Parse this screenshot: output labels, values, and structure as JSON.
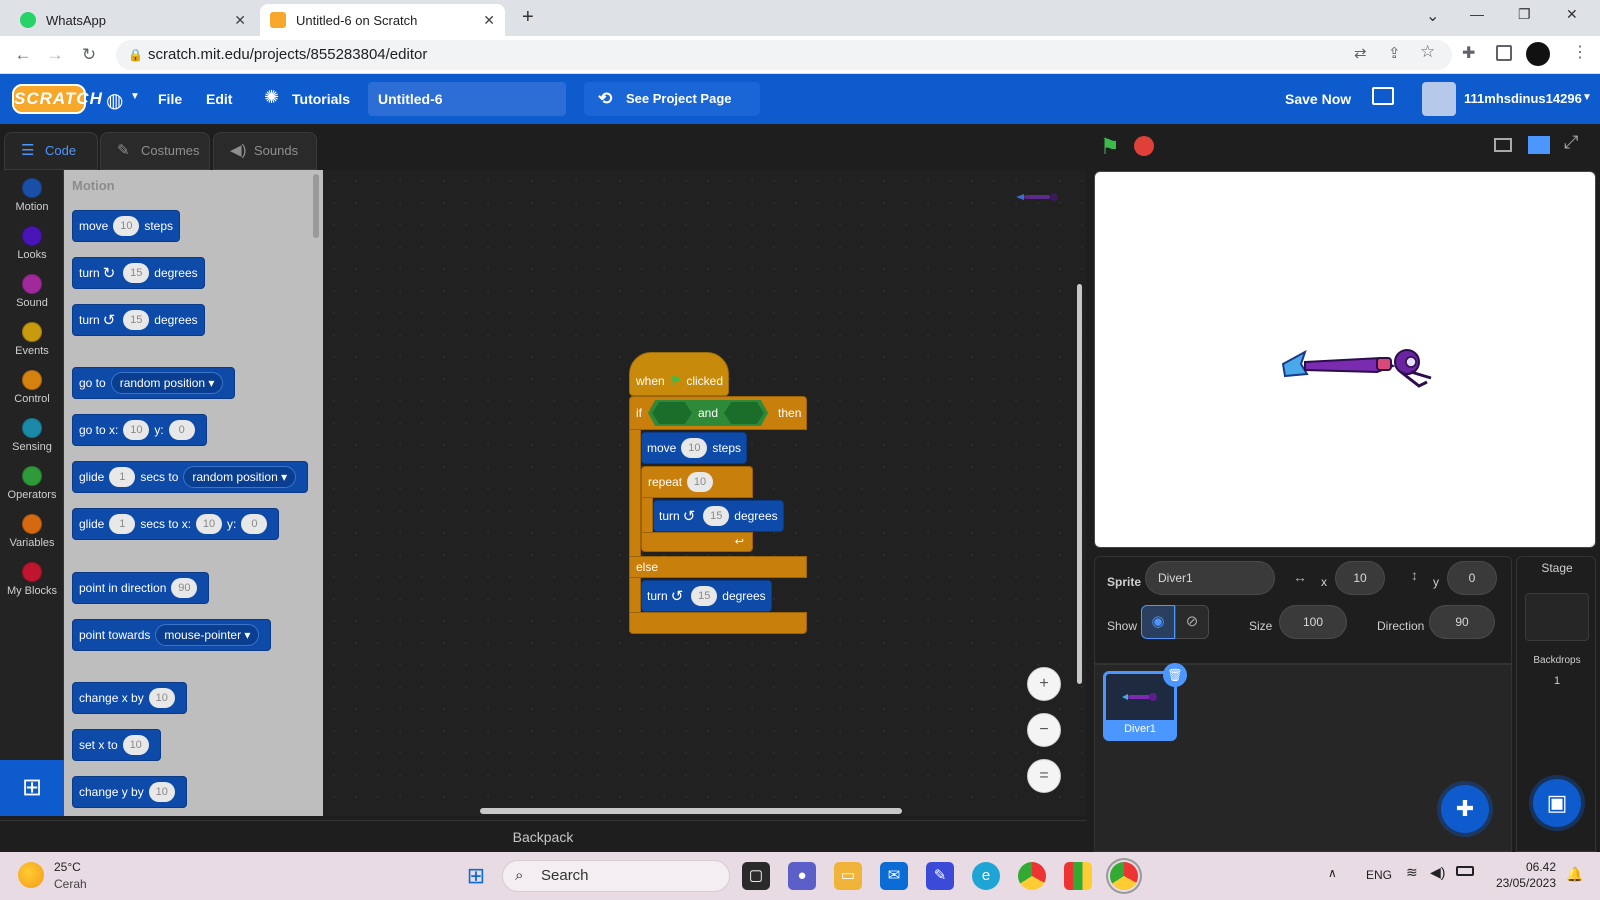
{
  "browser": {
    "tabs": [
      {
        "title": "WhatsApp",
        "active": false,
        "favicon": "whatsapp-icon",
        "color": "#25d366"
      },
      {
        "title": "Untitled-6 on Scratch",
        "active": true,
        "favicon": "scratch-icon",
        "color": "#f7a72a"
      }
    ],
    "new_tab": "+",
    "url": "scratch.mit.edu/projects/855283804/editor",
    "window_controls": {
      "dropdown": "⌄",
      "minimize": "—",
      "restore": "❐",
      "close": "✕"
    }
  },
  "menubar": {
    "logo": "SCRATCH",
    "language_icon": "globe-icon",
    "file": "File",
    "edit": "Edit",
    "tutorials": "Tutorials",
    "project_title": "Untitled-6",
    "see_project_page": "See Project Page",
    "save_now": "Save Now",
    "username": "111mhsdinus14296",
    "accent": "#0e5bce"
  },
  "editor_tabs": [
    {
      "label": "Code",
      "icon": "code-icon",
      "active": true
    },
    {
      "label": "Costumes",
      "icon": "brush-icon",
      "active": false
    },
    {
      "label": "Sounds",
      "icon": "speaker-icon",
      "active": false
    }
  ],
  "categories": [
    {
      "label": "Motion",
      "color": "#1a4fa8"
    },
    {
      "label": "Looks",
      "color": "#4a15b8"
    },
    {
      "label": "Sound",
      "color": "#a02a9c"
    },
    {
      "label": "Events",
      "color": "#c89a0e"
    },
    {
      "label": "Control",
      "color": "#d4810f"
    },
    {
      "label": "Sensing",
      "color": "#1a8aa8"
    },
    {
      "label": "Operators",
      "color": "#2f9a3a"
    },
    {
      "label": "Variables",
      "color": "#d46a10"
    },
    {
      "label": "My Blocks",
      "color": "#c0152e"
    }
  ],
  "palette": {
    "section_title": "Motion",
    "blocks": {
      "move": {
        "a": "move",
        "v": "10",
        "b": "steps"
      },
      "turn_cw": {
        "a": "turn",
        "v": "15",
        "b": "degrees"
      },
      "turn_ccw": {
        "a": "turn",
        "v": "15",
        "b": "degrees"
      },
      "goto": {
        "a": "go to",
        "dd": "random position"
      },
      "gotoxy": {
        "a": "go to x:",
        "x": "10",
        "b": "y:",
        "y": "0"
      },
      "glide_to": {
        "a": "glide",
        "v": "1",
        "b": "secs to",
        "dd": "random position"
      },
      "glide_xy": {
        "a": "glide",
        "v": "1",
        "b": "secs to x:",
        "x": "10",
        "c": "y:",
        "y": "0"
      },
      "point_dir": {
        "a": "point in direction",
        "v": "90"
      },
      "point_towards": {
        "a": "point towards",
        "dd": "mouse-pointer"
      },
      "change_x": {
        "a": "change x by",
        "v": "10"
      },
      "set_x": {
        "a": "set x to",
        "v": "10"
      },
      "change_y": {
        "a": "change y by",
        "v": "10"
      }
    }
  },
  "script": {
    "when": "when",
    "clicked": "clicked",
    "if": "if",
    "and": "and",
    "then": "then",
    "move": "move",
    "move_v": "10",
    "steps": "steps",
    "repeat": "repeat",
    "repeat_v": "10",
    "turn": "turn",
    "turn_v": "15",
    "degrees": "degrees",
    "else": "else",
    "else_turn": "turn",
    "else_turn_v": "15",
    "else_degrees": "degrees"
  },
  "workspace": {
    "zoom_in": "+",
    "zoom_out": "−",
    "zoom_reset": "=",
    "backpack": "Backpack"
  },
  "sprite_info": {
    "sprite_label": "Sprite",
    "sprite_name": "Diver1",
    "x_label": "x",
    "x": "10",
    "y_label": "y",
    "y": "0",
    "show_label": "Show",
    "size_label": "Size",
    "size": "100",
    "direction_label": "Direction",
    "direction": "90"
  },
  "sprites": [
    {
      "name": "Diver1"
    }
  ],
  "stage_panel": {
    "title": "Stage",
    "backdrops_label": "Backdrops",
    "backdrops_count": "1"
  },
  "taskbar": {
    "weather_temp": "25°C",
    "weather_desc": "Cerah",
    "search": "Search",
    "lang": "ENG",
    "time": "06.42",
    "date": "23/05/2023"
  }
}
